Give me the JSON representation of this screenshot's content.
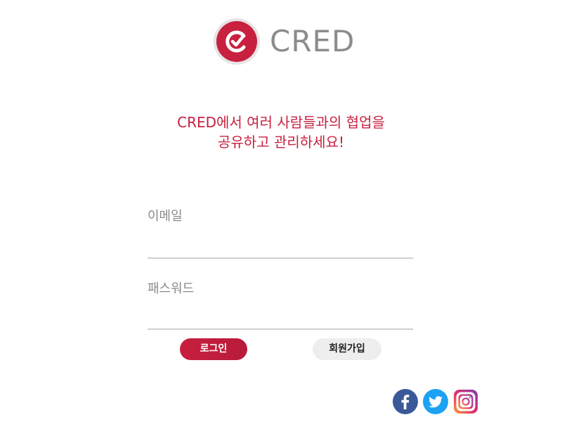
{
  "app": {
    "logo_text": "CRED"
  },
  "tagline": {
    "line1": "CRED에서 여러 사람들과의 협업을",
    "line2": "공유하고 관리하세요!"
  },
  "form": {
    "email_label": "이메일",
    "email_value": "",
    "password_label": "패스워드",
    "password_value": ""
  },
  "buttons": {
    "login_label": "로그인",
    "signup_label": "회원가입"
  },
  "social": {
    "icons": [
      "facebook-icon",
      "twitter-icon",
      "instagram-icon"
    ]
  },
  "colors": {
    "brand": "#c8203f",
    "label_gray": "#8a8a8a",
    "facebook": "#3b5998",
    "twitter": "#1da1f2"
  }
}
